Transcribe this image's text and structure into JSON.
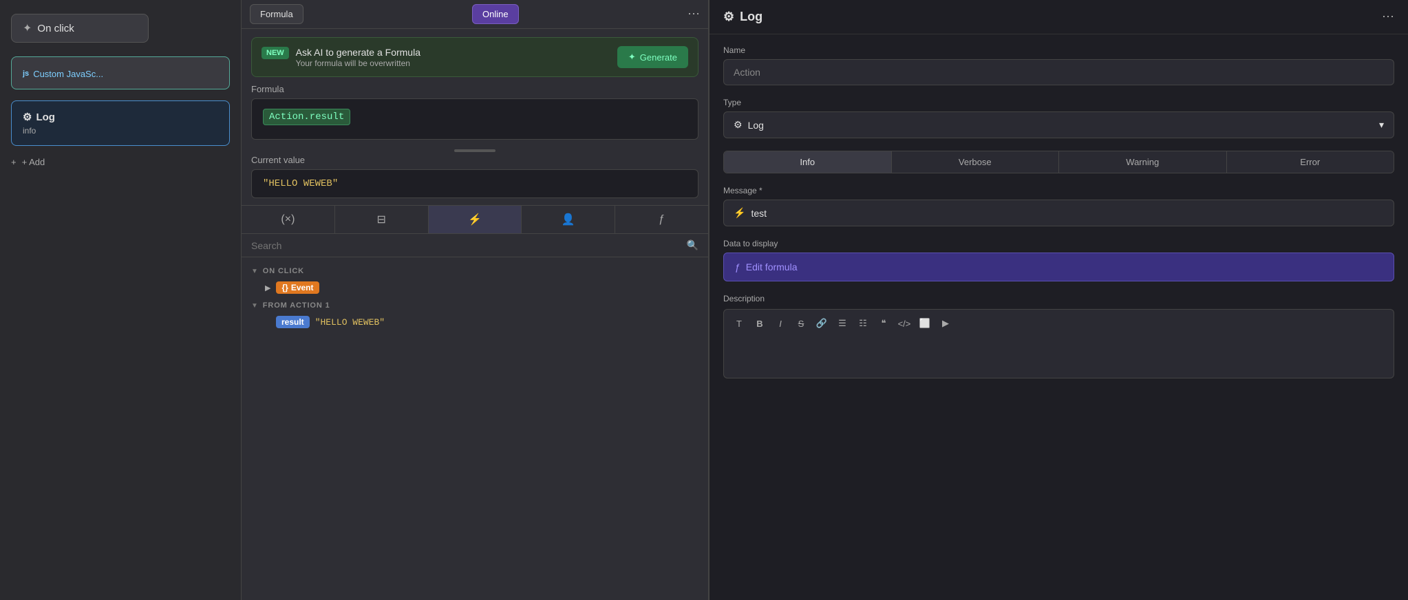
{
  "left": {
    "on_click_label": "On click",
    "custom_js_label": "Custom JavaSc...",
    "custom_js_prefix": "js",
    "log_title": "Log",
    "log_sub": "info",
    "add_label": "+ Add"
  },
  "center": {
    "tab_formula": "Formula",
    "tab_online": "Online",
    "ai_new_badge": "NEW",
    "ai_title": "Ask AI to generate a Formula",
    "ai_subtitle": "Your formula will be overwritten",
    "generate_btn": "Generate",
    "formula_label": "Formula",
    "formula_value": "Action.result",
    "current_value_label": "Current value",
    "current_value": "\"HELLO WEWEB\"",
    "search_placeholder": "Search",
    "tree": {
      "on_click_header": "ON CLICK",
      "event_label": "Event",
      "from_action_header": "FROM ACTION 1",
      "result_key": "result",
      "result_value": "\"HELLO WEWEB\""
    },
    "icon_tabs": [
      "(×)",
      "⊟",
      "⚡",
      "👤",
      "ƒ"
    ]
  },
  "right": {
    "header_title": "Log",
    "name_label": "Name",
    "name_placeholder": "Action",
    "type_label": "Type",
    "type_value": "Log",
    "log_levels": [
      "Info",
      "Verbose",
      "Warning",
      "Error"
    ],
    "active_level": "Info",
    "message_label": "Message *",
    "message_value": "test",
    "data_label": "Data to display",
    "edit_formula_label": "Edit formula",
    "description_label": "Description",
    "desc_tools": [
      "T",
      "B",
      "I",
      "S",
      "🔗",
      "☰",
      "☷",
      "❝",
      "</>",
      "⬜",
      "▶"
    ]
  }
}
